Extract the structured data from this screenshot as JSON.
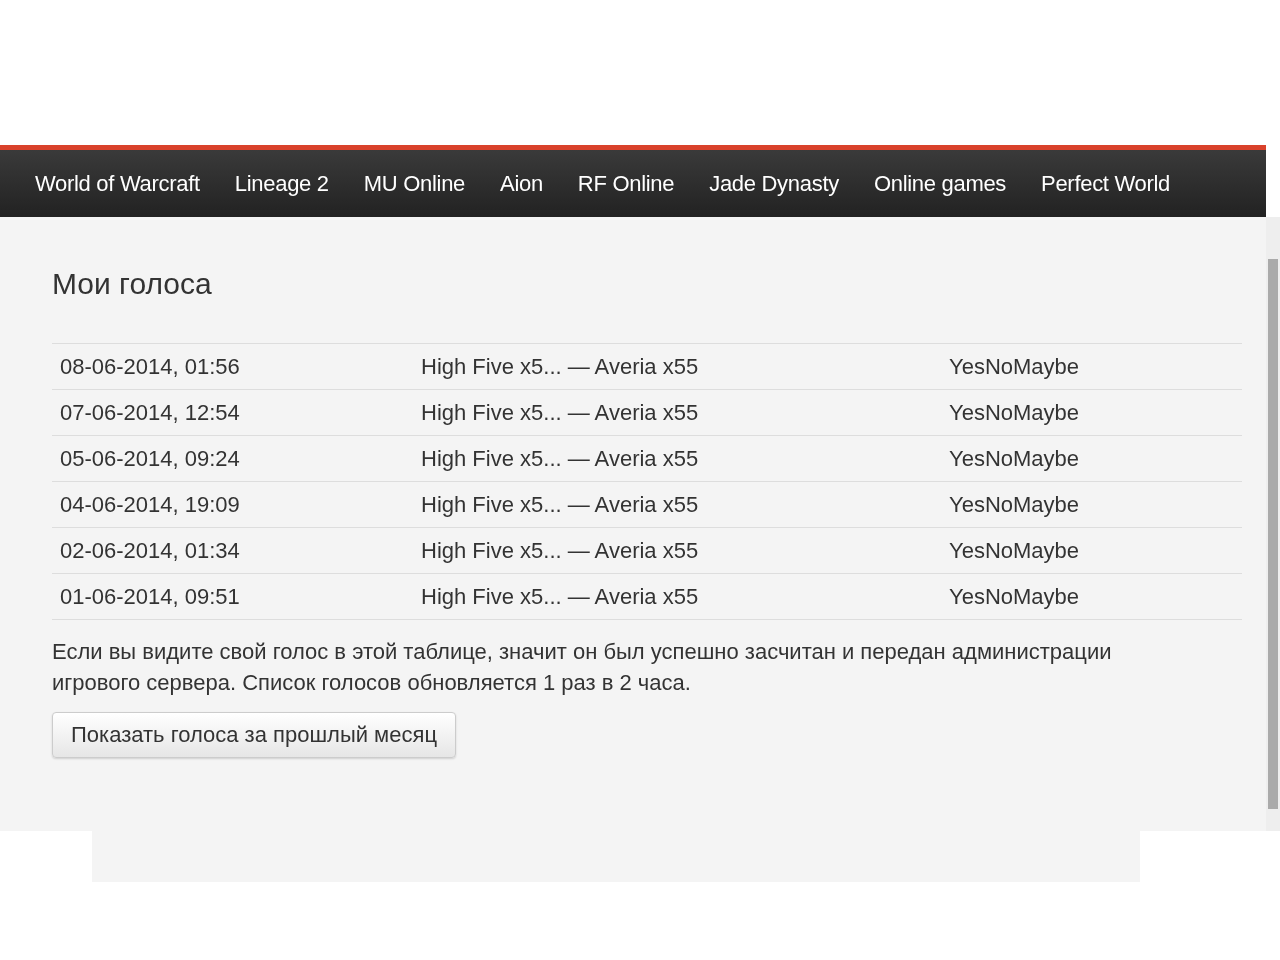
{
  "nav": {
    "items": [
      {
        "label": "World of Warcraft"
      },
      {
        "label": "Lineage 2"
      },
      {
        "label": "MU Online"
      },
      {
        "label": "Aion"
      },
      {
        "label": "RF Online"
      },
      {
        "label": "Jade Dynasty"
      },
      {
        "label": "Online games"
      },
      {
        "label": "Perfect World"
      }
    ]
  },
  "page": {
    "title": "Мои голоса",
    "table": {
      "rows": [
        {
          "date": "08-06-2014, 01:56",
          "server": "High Five x5... — Averia x55",
          "user": "YesNoMaybe"
        },
        {
          "date": "07-06-2014, 12:54",
          "server": "High Five x5... — Averia x55",
          "user": "YesNoMaybe"
        },
        {
          "date": "05-06-2014, 09:24",
          "server": "High Five x5... — Averia x55",
          "user": "YesNoMaybe"
        },
        {
          "date": "04-06-2014, 19:09",
          "server": "High Five x5... — Averia x55",
          "user": "YesNoMaybe"
        },
        {
          "date": "02-06-2014, 01:34",
          "server": "High Five x5... — Averia x55",
          "user": "YesNoMaybe"
        },
        {
          "date": "01-06-2014, 09:51",
          "server": "High Five x5... — Averia x55",
          "user": "YesNoMaybe"
        }
      ]
    },
    "note": "Если вы видите свой голос в этой таблице, значит он был успешно засчитан и передан администрации игрового сервера. Список голосов обновляется 1 раз в 2 часа.",
    "button": "Показать голоса за прошлый месяц"
  }
}
